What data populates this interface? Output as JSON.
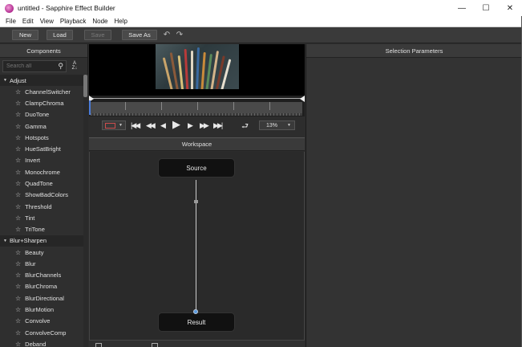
{
  "window": {
    "title": "untitled - Sapphire Effect Builder",
    "controls": [
      "—",
      "☐",
      "✕"
    ]
  },
  "menu": [
    "File",
    "Edit",
    "View",
    "Playback",
    "Node",
    "Help"
  ],
  "toolbar": {
    "new": "New",
    "load": "Load",
    "save": "Save",
    "save_as": "Save As"
  },
  "components": {
    "header": "Components",
    "search_placeholder": "Search all",
    "groups": [
      {
        "name": "Adjust",
        "items": [
          "ChannelSwitcher",
          "ClampChroma",
          "DuoTone",
          "Gamma",
          "Hotspots",
          "HueSatBright",
          "Invert",
          "Monochrome",
          "QuadTone",
          "ShowBadColors",
          "Threshold",
          "Tint",
          "TriTone"
        ]
      },
      {
        "name": "Blur+Sharpen",
        "items": [
          "Beauty",
          "Blur",
          "BlurChannels",
          "BlurChroma",
          "BlurDirectional",
          "BlurMotion",
          "Convolve",
          "ConvolveComp",
          "Deband"
        ]
      }
    ]
  },
  "transport": {
    "zoom": "13%"
  },
  "workspace": {
    "header": "Workspace",
    "source_node": "Source",
    "result_node": "Result"
  },
  "selection": {
    "header": "Selection Parameters"
  }
}
